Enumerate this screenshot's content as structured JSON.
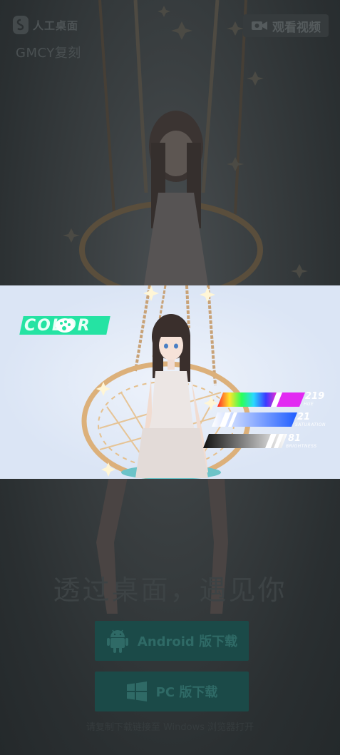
{
  "header": {
    "logo_text": "人工桌面",
    "subtitle": "GMCY复刻",
    "watch_label": "观看视频"
  },
  "banner": {
    "color_tag": "COLOR",
    "hue": {
      "value": "219",
      "label": "HUE"
    },
    "saturation": {
      "value": "21",
      "label": "SATURATION"
    },
    "brightness": {
      "value": "81",
      "label": "BRIGHTNESS"
    }
  },
  "main": {
    "tagline": "透过桌面，遇见你",
    "android_label": "Android 版下载",
    "pc_label": "PC 版下载",
    "note": "请复制下载链接至 Windows 浏览器打开"
  },
  "colors": {
    "accent": "#25e3a3",
    "button_bg": "#1b4a48",
    "overlay": "#2b3032",
    "banner_bg": "#dfe7f6"
  },
  "icons": [
    "logo-icon",
    "video-icon",
    "android-icon",
    "windows-icon"
  ]
}
